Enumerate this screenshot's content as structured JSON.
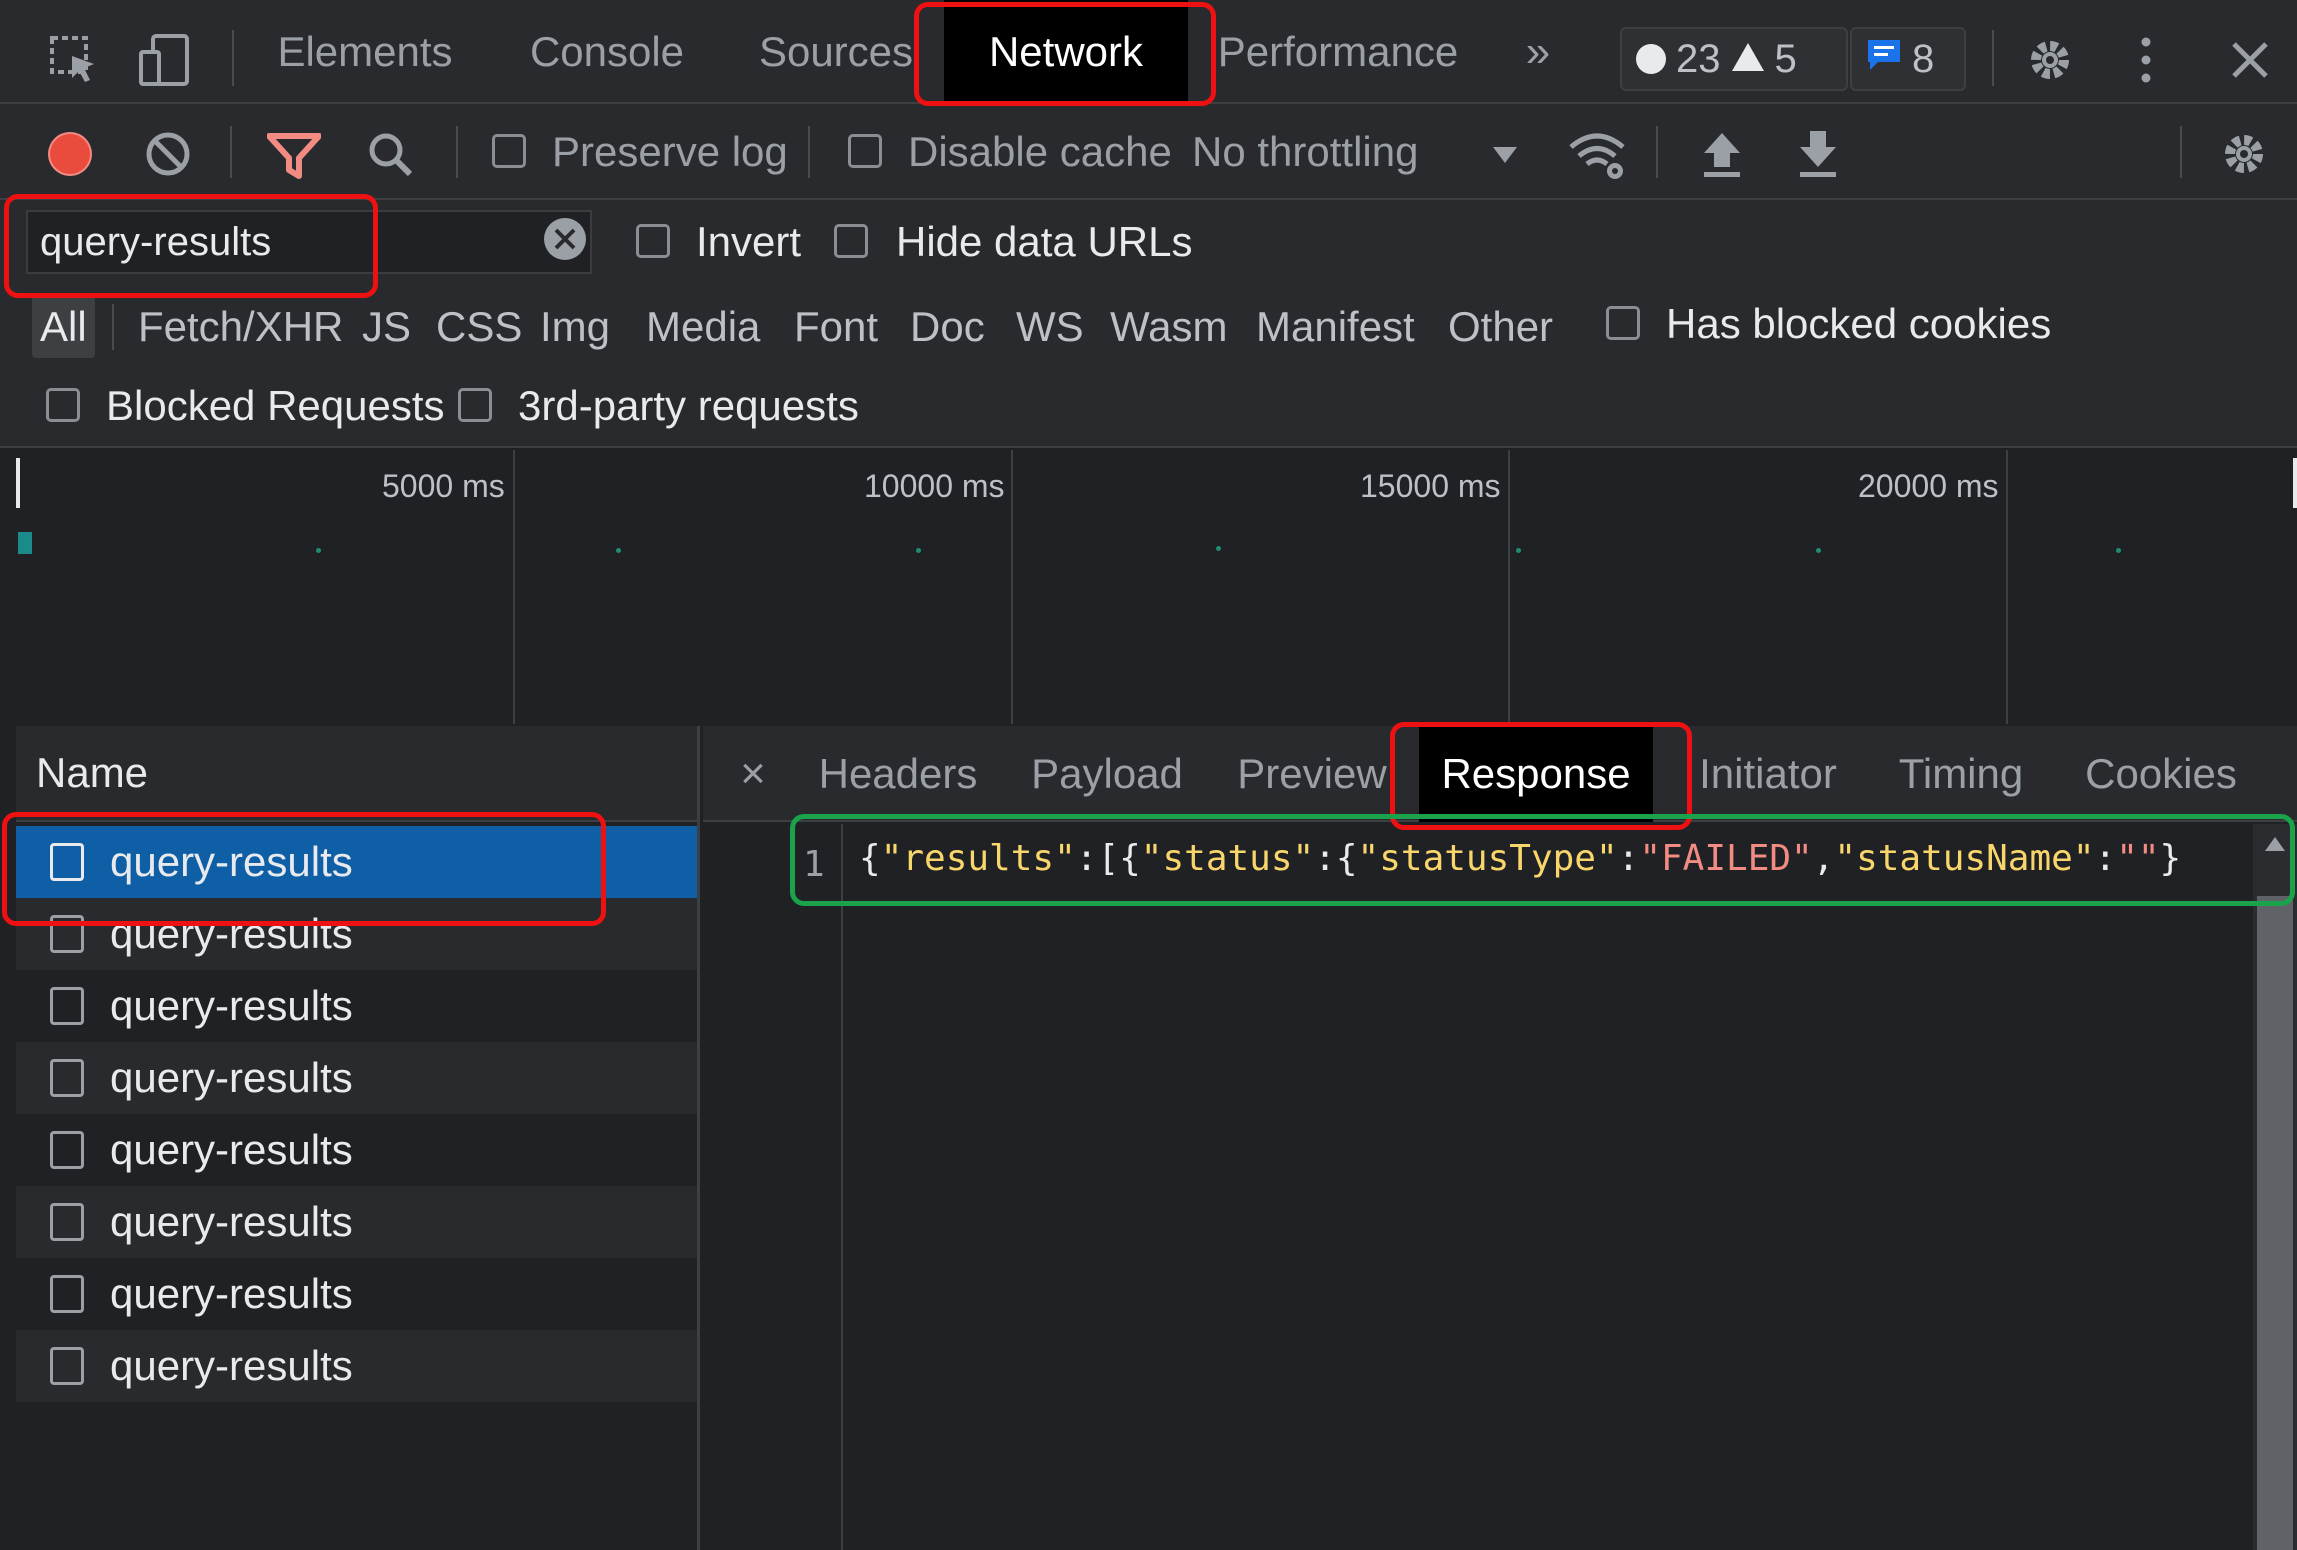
{
  "tabs": {
    "items": [
      "Elements",
      "Console",
      "Sources",
      "Network",
      "Performance"
    ],
    "active": "Network",
    "more": "»"
  },
  "badges": {
    "errors": "23",
    "warnings": "5",
    "messages": "8"
  },
  "toolbar": {
    "preserve_log": "Preserve log",
    "disable_cache": "Disable cache",
    "throttling": "No throttling"
  },
  "filter": {
    "value": "query-results",
    "invert": "Invert",
    "hide_data_urls": "Hide data URLs",
    "types": [
      "All",
      "Fetch/XHR",
      "JS",
      "CSS",
      "Img",
      "Media",
      "Font",
      "Doc",
      "WS",
      "Wasm",
      "Manifest",
      "Other"
    ],
    "has_blocked_cookies": "Has blocked cookies",
    "blocked_requests": "Blocked Requests",
    "third_party": "3rd-party requests"
  },
  "overview": {
    "ticks": [
      "5000 ms",
      "10000 ms",
      "15000 ms",
      "20000 ms"
    ]
  },
  "request_list": {
    "header": "Name",
    "items": [
      "query-results",
      "query-results",
      "query-results",
      "query-results",
      "query-results",
      "query-results",
      "query-results",
      "query-results"
    ]
  },
  "detail": {
    "close": "×",
    "tabs": [
      "Headers",
      "Payload",
      "Preview",
      "Response",
      "Initiator",
      "Timing",
      "Cookies"
    ],
    "active": "Response",
    "line_number": "1",
    "response": {
      "p1": "{",
      "k1": "\"results\"",
      "p2": ":[{",
      "k2": "\"status\"",
      "p3": ":{",
      "k3": "\"statusType\"",
      "p4": ":",
      "s1": "\"FAILED\"",
      "p5": ",",
      "k4": "\"statusName\"",
      "p6": ":",
      "s2": "\"\"",
      "p7": "}"
    }
  },
  "colors": {
    "accent": "#0e5fa6",
    "annotation_red": "#ee1111",
    "annotation_green": "#1aa34a"
  }
}
